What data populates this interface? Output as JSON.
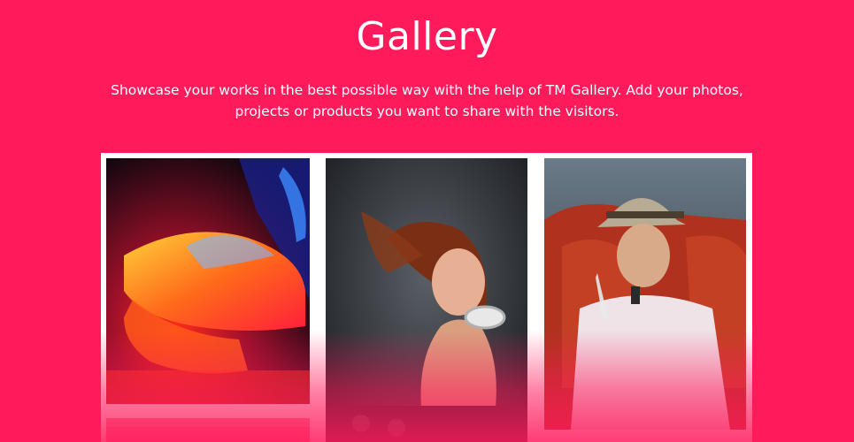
{
  "header": {
    "title": "Gallery",
    "description": "Showcase your works in the best possible way with the help of TM Gallery. Add your photos, projects or products you want to share with the visitors."
  },
  "gallery": {
    "items": [
      {
        "alt": "neon high-heel shoe"
      },
      {
        "alt": "dj woman with headphones"
      },
      {
        "alt": "man in hat with drink"
      }
    ]
  },
  "colors": {
    "background": "#ff1a5b",
    "text": "#ffffff",
    "frame": "#ffffff"
  }
}
